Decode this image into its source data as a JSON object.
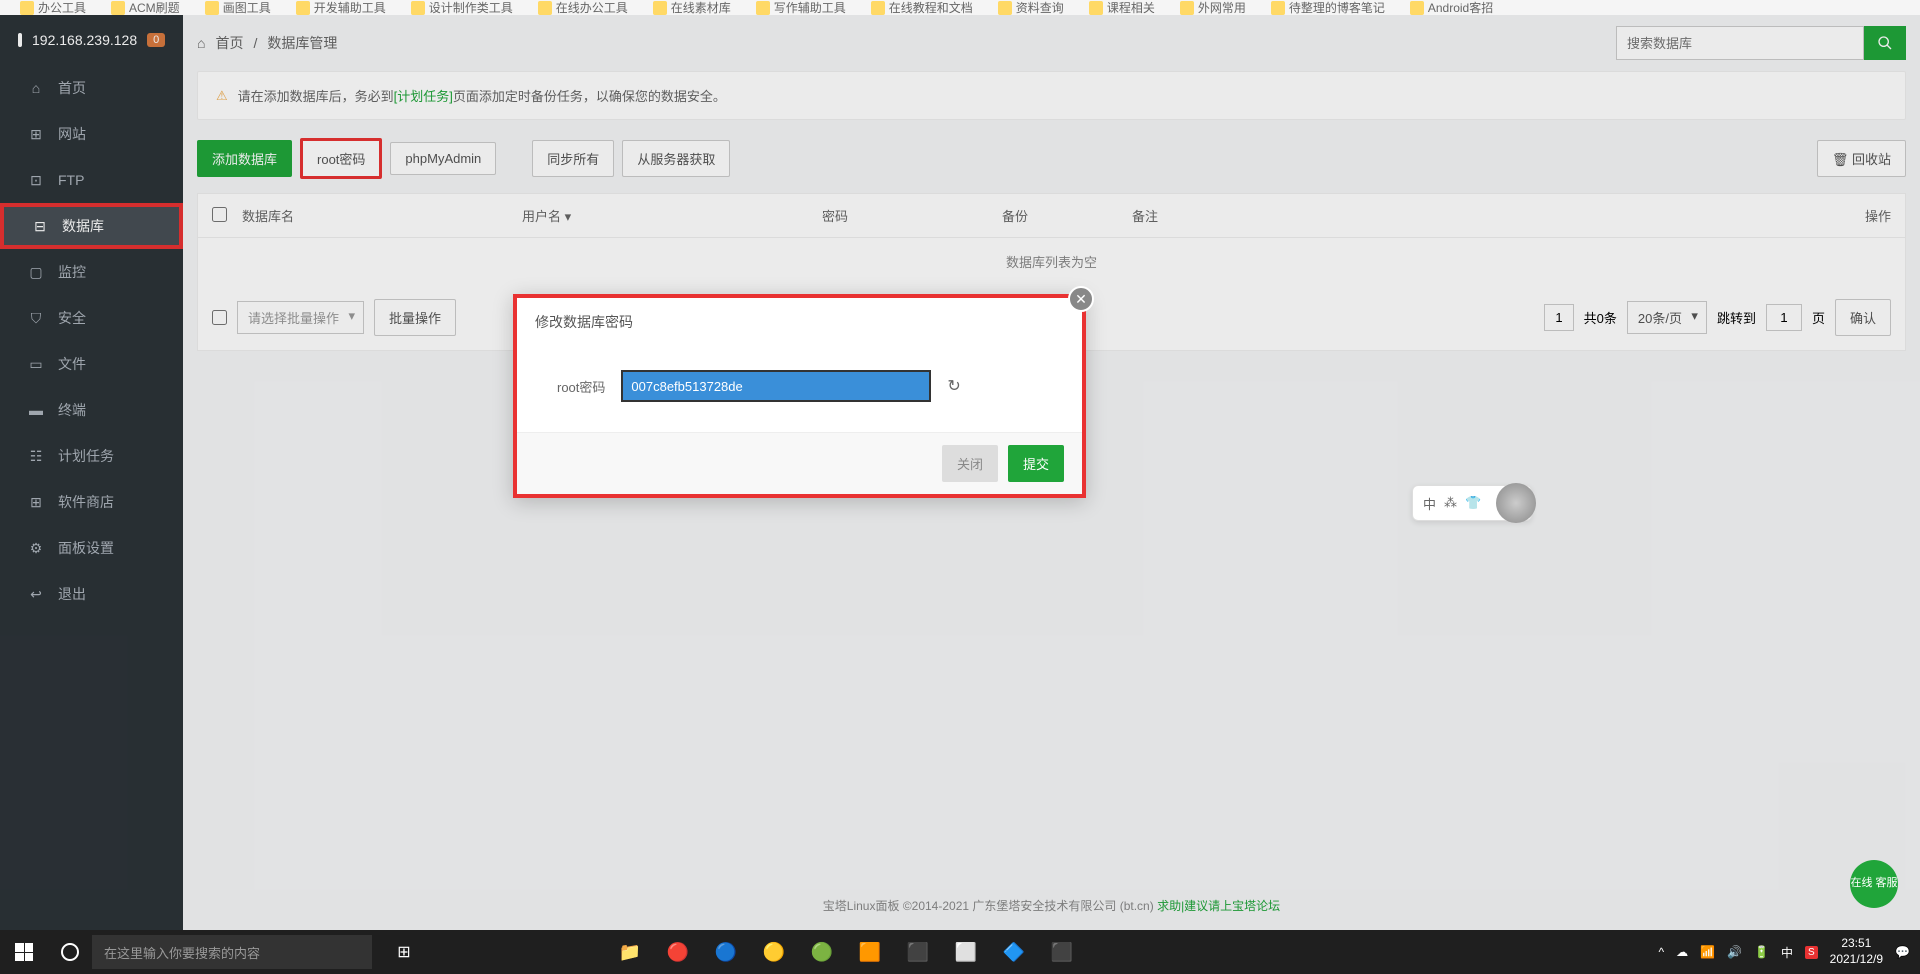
{
  "bookmarks": [
    "办公工具",
    "ACM刷题",
    "画图工具",
    "开发辅助工具",
    "设计制作类工具",
    "在线办公工具",
    "在线素材库",
    "写作辅助工具",
    "在线教程和文档",
    "资料查询",
    "课程相关",
    "外网常用",
    "待整理的博客笔记",
    "Android客招"
  ],
  "sidebar": {
    "ip": "192.168.239.128",
    "badge": "0",
    "items": [
      {
        "label": "首页",
        "icon": "⌂"
      },
      {
        "label": "网站",
        "icon": "⊞"
      },
      {
        "label": "FTP",
        "icon": "⊡"
      },
      {
        "label": "数据库",
        "icon": "⊟",
        "active": true,
        "highlighted": true
      },
      {
        "label": "监控",
        "icon": "▢"
      },
      {
        "label": "安全",
        "icon": "⛉"
      },
      {
        "label": "文件",
        "icon": "▭"
      },
      {
        "label": "终端",
        "icon": "▬"
      },
      {
        "label": "计划任务",
        "icon": "☷"
      },
      {
        "label": "软件商店",
        "icon": "⊞"
      },
      {
        "label": "面板设置",
        "icon": "⚙"
      },
      {
        "label": "退出",
        "icon": "↩"
      }
    ]
  },
  "breadcrumb": {
    "home": "首页",
    "sep": "/",
    "current": "数据库管理"
  },
  "search": {
    "placeholder": "搜索数据库"
  },
  "alert": {
    "prefix": "请在添加数据库后，务必到",
    "link": "[计划任务]",
    "suffix": "页面添加定时备份任务，以确保您的数据安全。"
  },
  "toolbar": {
    "add": "添加数据库",
    "rootpwd": "root密码",
    "phpmyadmin": "phpMyAdmin",
    "syncall": "同步所有",
    "fromserver": "从服务器获取",
    "recycle": "回收站"
  },
  "table": {
    "cols": {
      "name": "数据库名",
      "user": "用户名",
      "pwd": "密码",
      "backup": "备份",
      "note": "备注",
      "op": "操作"
    },
    "empty": "数据库列表为空"
  },
  "footer": {
    "batch_select": "请选择批量操作",
    "batch_btn": "批量操作",
    "page_current": "1",
    "total": "共0条",
    "per_page": "20条/页",
    "jump_label": "跳转到",
    "jump_value": "1",
    "page_unit": "页",
    "confirm": "确认"
  },
  "modal": {
    "title": "修改数据库密码",
    "label": "root密码",
    "value": "007c8efb513728de",
    "close": "关闭",
    "submit": "提交"
  },
  "pagefooter": {
    "text": "宝塔Linux面板 ©2014-2021 广东堡塔安全技术有限公司 (bt.cn) ",
    "link": "求助|建议请上宝塔论坛"
  },
  "ime": {
    "lang": "中"
  },
  "support": "在线\n客服",
  "taskbar": {
    "search_placeholder": "在这里输入你要搜索的内容",
    "time": "23:51",
    "date": "2021/12/9"
  }
}
